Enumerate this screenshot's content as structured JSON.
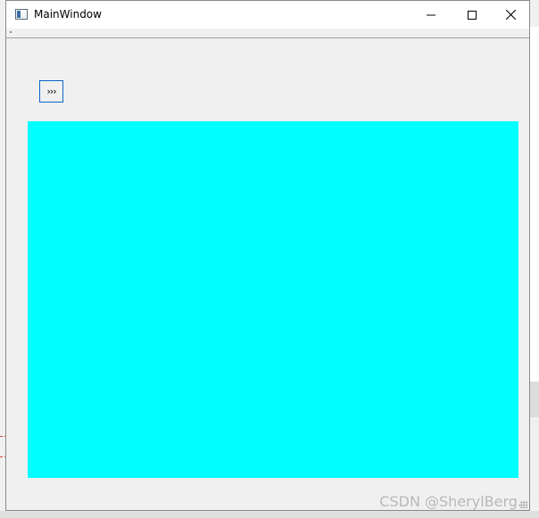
{
  "window": {
    "title": "MainWindow",
    "icon": "app-window-icon"
  },
  "caption_buttons": {
    "minimize_icon": "minimize-icon",
    "maximize_icon": "maximize-icon",
    "close_icon": "close-icon"
  },
  "toolbar": {
    "expand_label": "›››"
  },
  "panel": {
    "color": "#00ffff"
  },
  "watermark": {
    "text": "CSDN @SherylBerg."
  }
}
